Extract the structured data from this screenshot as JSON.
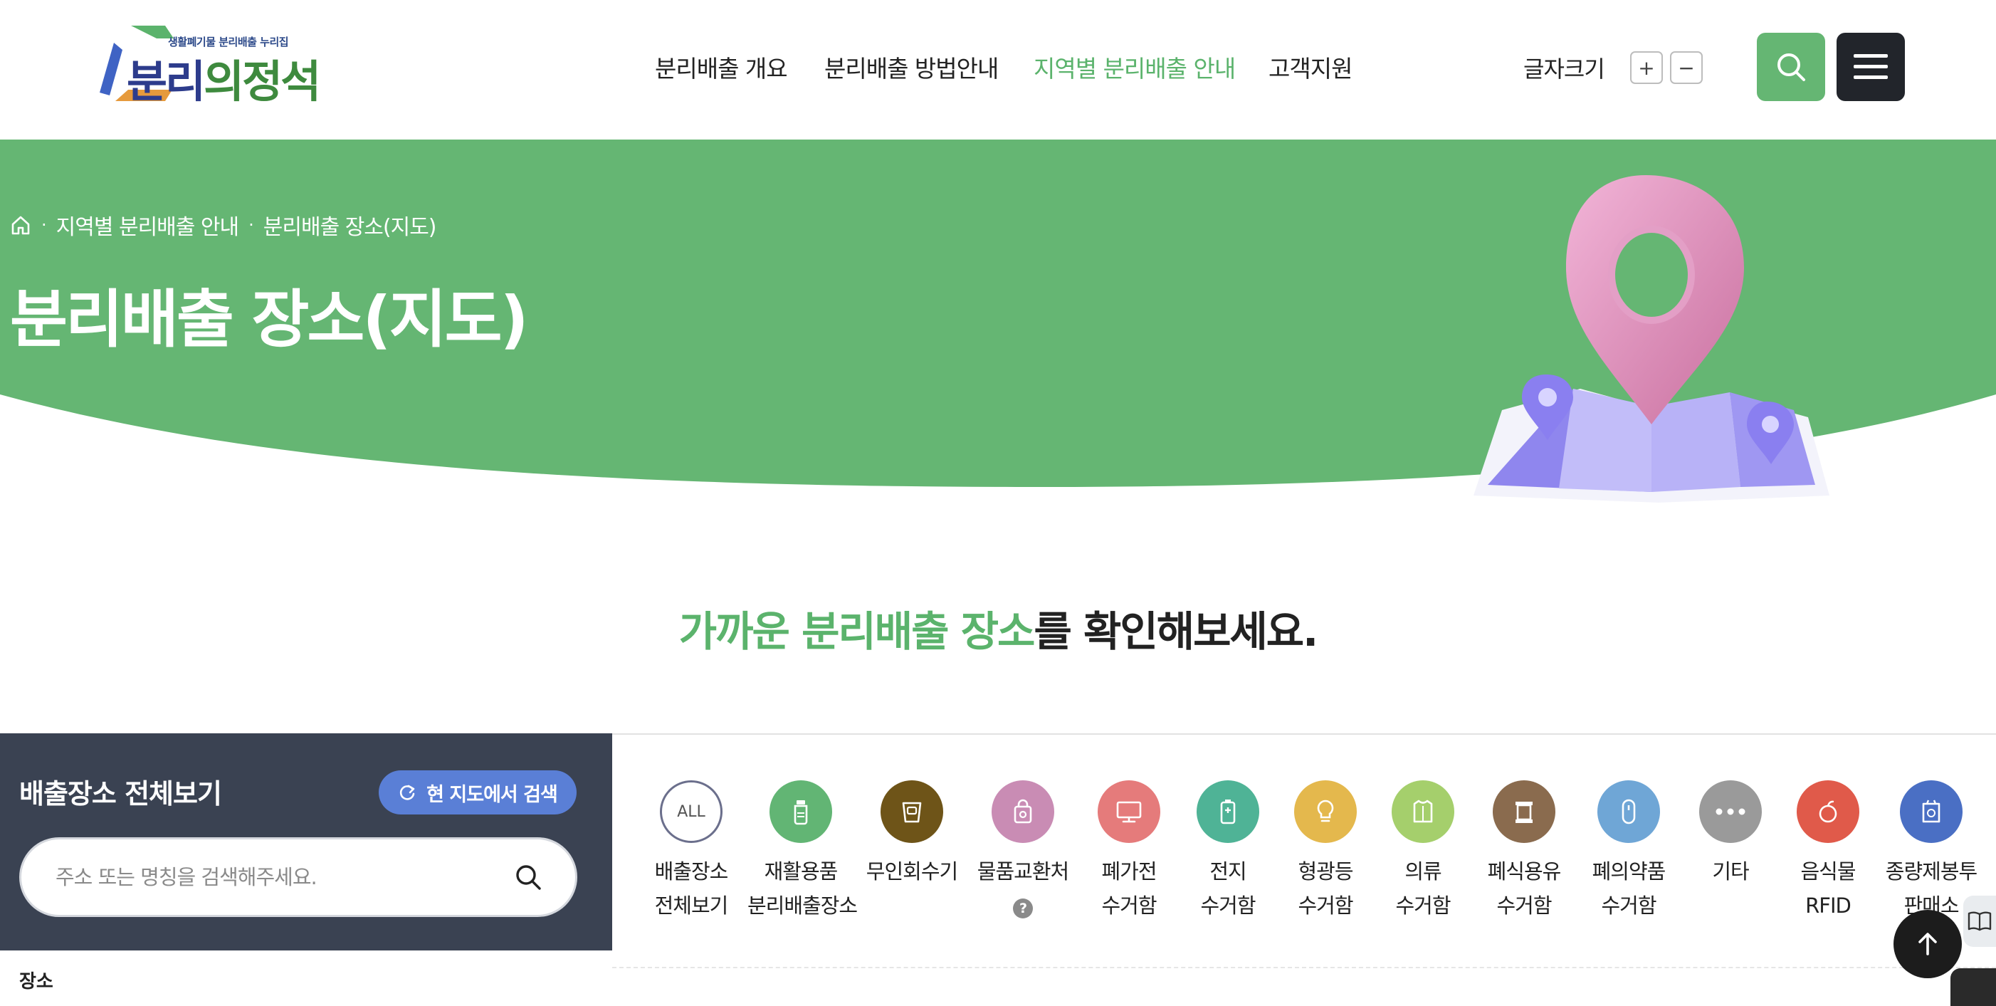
{
  "header": {
    "logo": {
      "subtitle": "생활폐기물 분리배출 누리집",
      "title_part1": "분리",
      "title_part2": "의정석"
    },
    "nav": [
      {
        "label": "분리배출 개요",
        "active": false
      },
      {
        "label": "분리배출 방법안내",
        "active": false
      },
      {
        "label": "지역별 분리배출 안내",
        "active": true
      },
      {
        "label": "고객지원",
        "active": false
      }
    ],
    "font_size": {
      "label": "글자크기",
      "increase": "+",
      "decrease": "−"
    },
    "accent_color": "#65b673"
  },
  "hero": {
    "breadcrumb": [
      "지역별 분리배출 안내",
      "분리배출 장소(지도)"
    ],
    "title": "분리배출 장소(지도)",
    "background_color": "#65b673"
  },
  "intro": {
    "highlight": "가까운 분리배출 장소",
    "rest": "를 확인해보세요."
  },
  "left_panel": {
    "title": "배출장소 전체보기",
    "map_search_button": "현 지도에서 검색",
    "search_placeholder": "주소 또는 명칭을 검색해주세요.",
    "place_label": "장소"
  },
  "categories": [
    {
      "line1": "배출장소",
      "line2": "전체보기",
      "icon": "all-icon",
      "color": "#ffffff",
      "badge": "ALL"
    },
    {
      "line1": "재활용품",
      "line2": "분리배출장소",
      "icon": "bottle-icon",
      "color": "#62b574"
    },
    {
      "line1": "무인회수기",
      "line2": "",
      "icon": "recycling-machine-icon",
      "color": "#6e5418"
    },
    {
      "line1": "물품교환처",
      "line2": "",
      "icon": "exchange-bag-icon",
      "color": "#c98cb4",
      "help": "?"
    },
    {
      "line1": "폐가전",
      "line2": "수거함",
      "icon": "monitor-icon",
      "color": "#e57b7b"
    },
    {
      "line1": "전지",
      "line2": "수거함",
      "icon": "battery-icon",
      "color": "#4fb396"
    },
    {
      "line1": "형광등",
      "line2": "수거함",
      "icon": "bulb-icon",
      "color": "#e4b84d"
    },
    {
      "line1": "의류",
      "line2": "수거함",
      "icon": "clothes-icon",
      "color": "#a5cf6c"
    },
    {
      "line1": "폐식용유",
      "line2": "수거함",
      "icon": "oil-icon",
      "color": "#8a6b4e"
    },
    {
      "line1": "폐의약품",
      "line2": "수거함",
      "icon": "pill-icon",
      "color": "#6fa6d6"
    },
    {
      "line1": "기타",
      "line2": "",
      "icon": "more-icon",
      "color": "#9a9a9a"
    },
    {
      "line1": "음식물",
      "line2": "RFID",
      "icon": "food-icon",
      "color": "#e05a4a"
    },
    {
      "line1": "종량제봉투",
      "line2": "판매소",
      "icon": "bag-icon",
      "color": "#4a6fc4"
    }
  ]
}
